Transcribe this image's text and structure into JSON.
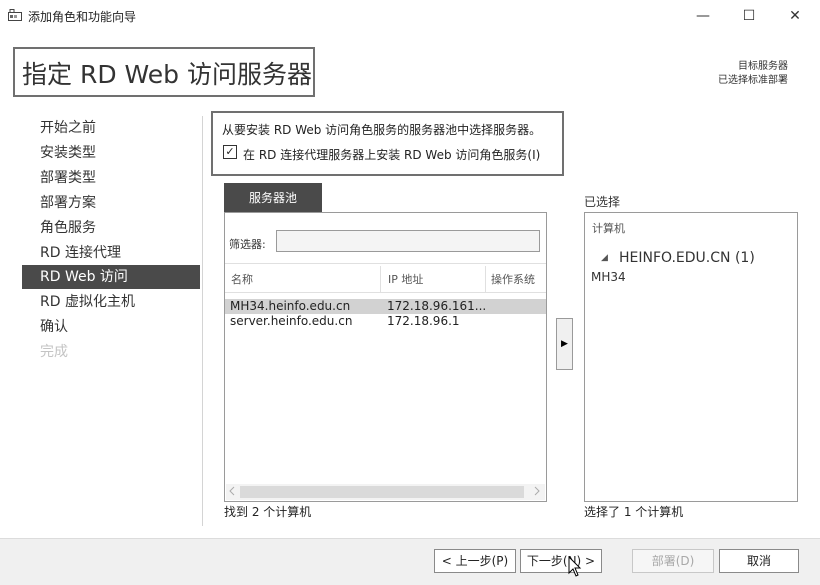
{
  "window": {
    "title": "添加角色和功能向导",
    "controls": {
      "minimize": "—",
      "maximize": "☐",
      "close": "✕"
    }
  },
  "header": {
    "page_title": "指定 RD Web 访问服务器",
    "destination_label": "目标服务器",
    "destination_value": "已选择标准部署"
  },
  "nav": {
    "items": [
      {
        "label": "开始之前",
        "state": "normal"
      },
      {
        "label": "安装类型",
        "state": "normal"
      },
      {
        "label": "部署类型",
        "state": "normal"
      },
      {
        "label": "部署方案",
        "state": "normal"
      },
      {
        "label": "角色服务",
        "state": "normal"
      },
      {
        "label": "RD 连接代理",
        "state": "normal"
      },
      {
        "label": "RD Web 访问",
        "state": "active"
      },
      {
        "label": "RD 虚拟化主机",
        "state": "normal"
      },
      {
        "label": "确认",
        "state": "normal"
      },
      {
        "label": "完成",
        "state": "disabled"
      }
    ]
  },
  "instruction": {
    "text": "从要安装 RD Web 访问角色服务的服务器池中选择服务器。",
    "checkbox_label": "在 RD 连接代理服务器上安装 RD Web 访问角色服务(I)",
    "checkbox_mark": "✓",
    "checked": true
  },
  "pool": {
    "tab_label": "服务器池",
    "filter_label": "筛选器:",
    "filter_value": "",
    "columns": [
      "名称",
      "IP 地址",
      "操作系统"
    ],
    "rows": [
      {
        "name": "MH34.heinfo.edu.cn",
        "ip": "172.18.96.161...",
        "os": "",
        "selected": true
      },
      {
        "name": "server.heinfo.edu.cn",
        "ip": "172.18.96.1",
        "os": "",
        "selected": false
      }
    ],
    "found_text": "找到 2 个计算机"
  },
  "add_button": {
    "icon": "▶"
  },
  "selected": {
    "label": "已选择",
    "column": "计算机",
    "group_arrow": "◢",
    "group": "HEINFO.EDU.CN (1)",
    "items": [
      "MH34"
    ],
    "count_text": "选择了 1 个计算机"
  },
  "footer": {
    "prev_label": "< 上一步(P)",
    "next_label": "下一步(N) >",
    "deploy_label": "部署(D)",
    "cancel_label": "取消"
  },
  "colors": {
    "active_nav_bg": "#4a4a4a",
    "selected_row_bg": "#d2d2d2",
    "footer_bg": "#f0f0f0"
  },
  "icons": [
    "app-icon",
    "minimize-icon",
    "maximize-icon",
    "close-icon",
    "checkmark-icon",
    "right-arrow-icon",
    "tree-expand-icon",
    "cursor-icon"
  ]
}
